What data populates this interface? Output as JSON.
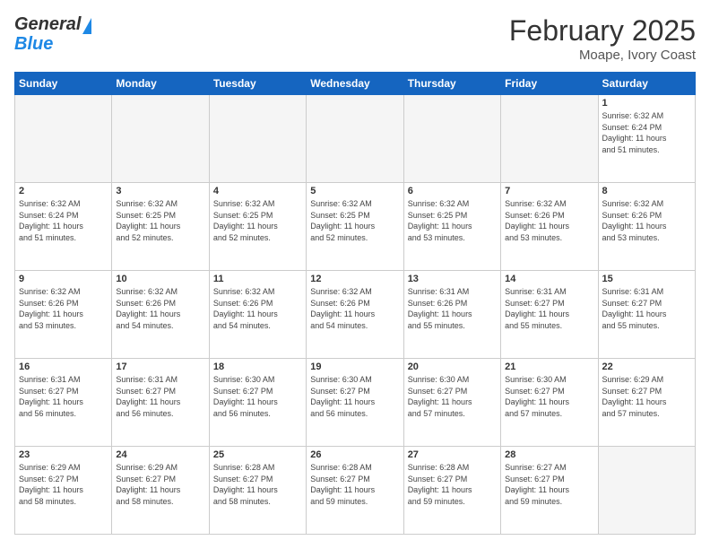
{
  "header": {
    "logo_line1": "General",
    "logo_line2": "Blue",
    "month": "February 2025",
    "location": "Moape, Ivory Coast"
  },
  "days_of_week": [
    "Sunday",
    "Monday",
    "Tuesday",
    "Wednesday",
    "Thursday",
    "Friday",
    "Saturday"
  ],
  "weeks": [
    [
      {
        "day": "",
        "info": ""
      },
      {
        "day": "",
        "info": ""
      },
      {
        "day": "",
        "info": ""
      },
      {
        "day": "",
        "info": ""
      },
      {
        "day": "",
        "info": ""
      },
      {
        "day": "",
        "info": ""
      },
      {
        "day": "1",
        "info": "Sunrise: 6:32 AM\nSunset: 6:24 PM\nDaylight: 11 hours\nand 51 minutes."
      }
    ],
    [
      {
        "day": "2",
        "info": "Sunrise: 6:32 AM\nSunset: 6:24 PM\nDaylight: 11 hours\nand 51 minutes."
      },
      {
        "day": "3",
        "info": "Sunrise: 6:32 AM\nSunset: 6:25 PM\nDaylight: 11 hours\nand 52 minutes."
      },
      {
        "day": "4",
        "info": "Sunrise: 6:32 AM\nSunset: 6:25 PM\nDaylight: 11 hours\nand 52 minutes."
      },
      {
        "day": "5",
        "info": "Sunrise: 6:32 AM\nSunset: 6:25 PM\nDaylight: 11 hours\nand 52 minutes."
      },
      {
        "day": "6",
        "info": "Sunrise: 6:32 AM\nSunset: 6:25 PM\nDaylight: 11 hours\nand 53 minutes."
      },
      {
        "day": "7",
        "info": "Sunrise: 6:32 AM\nSunset: 6:26 PM\nDaylight: 11 hours\nand 53 minutes."
      },
      {
        "day": "8",
        "info": "Sunrise: 6:32 AM\nSunset: 6:26 PM\nDaylight: 11 hours\nand 53 minutes."
      }
    ],
    [
      {
        "day": "9",
        "info": "Sunrise: 6:32 AM\nSunset: 6:26 PM\nDaylight: 11 hours\nand 53 minutes."
      },
      {
        "day": "10",
        "info": "Sunrise: 6:32 AM\nSunset: 6:26 PM\nDaylight: 11 hours\nand 54 minutes."
      },
      {
        "day": "11",
        "info": "Sunrise: 6:32 AM\nSunset: 6:26 PM\nDaylight: 11 hours\nand 54 minutes."
      },
      {
        "day": "12",
        "info": "Sunrise: 6:32 AM\nSunset: 6:26 PM\nDaylight: 11 hours\nand 54 minutes."
      },
      {
        "day": "13",
        "info": "Sunrise: 6:31 AM\nSunset: 6:26 PM\nDaylight: 11 hours\nand 55 minutes."
      },
      {
        "day": "14",
        "info": "Sunrise: 6:31 AM\nSunset: 6:27 PM\nDaylight: 11 hours\nand 55 minutes."
      },
      {
        "day": "15",
        "info": "Sunrise: 6:31 AM\nSunset: 6:27 PM\nDaylight: 11 hours\nand 55 minutes."
      }
    ],
    [
      {
        "day": "16",
        "info": "Sunrise: 6:31 AM\nSunset: 6:27 PM\nDaylight: 11 hours\nand 56 minutes."
      },
      {
        "day": "17",
        "info": "Sunrise: 6:31 AM\nSunset: 6:27 PM\nDaylight: 11 hours\nand 56 minutes."
      },
      {
        "day": "18",
        "info": "Sunrise: 6:30 AM\nSunset: 6:27 PM\nDaylight: 11 hours\nand 56 minutes."
      },
      {
        "day": "19",
        "info": "Sunrise: 6:30 AM\nSunset: 6:27 PM\nDaylight: 11 hours\nand 56 minutes."
      },
      {
        "day": "20",
        "info": "Sunrise: 6:30 AM\nSunset: 6:27 PM\nDaylight: 11 hours\nand 57 minutes."
      },
      {
        "day": "21",
        "info": "Sunrise: 6:30 AM\nSunset: 6:27 PM\nDaylight: 11 hours\nand 57 minutes."
      },
      {
        "day": "22",
        "info": "Sunrise: 6:29 AM\nSunset: 6:27 PM\nDaylight: 11 hours\nand 57 minutes."
      }
    ],
    [
      {
        "day": "23",
        "info": "Sunrise: 6:29 AM\nSunset: 6:27 PM\nDaylight: 11 hours\nand 58 minutes."
      },
      {
        "day": "24",
        "info": "Sunrise: 6:29 AM\nSunset: 6:27 PM\nDaylight: 11 hours\nand 58 minutes."
      },
      {
        "day": "25",
        "info": "Sunrise: 6:28 AM\nSunset: 6:27 PM\nDaylight: 11 hours\nand 58 minutes."
      },
      {
        "day": "26",
        "info": "Sunrise: 6:28 AM\nSunset: 6:27 PM\nDaylight: 11 hours\nand 59 minutes."
      },
      {
        "day": "27",
        "info": "Sunrise: 6:28 AM\nSunset: 6:27 PM\nDaylight: 11 hours\nand 59 minutes."
      },
      {
        "day": "28",
        "info": "Sunrise: 6:27 AM\nSunset: 6:27 PM\nDaylight: 11 hours\nand 59 minutes."
      },
      {
        "day": "",
        "info": ""
      }
    ]
  ]
}
